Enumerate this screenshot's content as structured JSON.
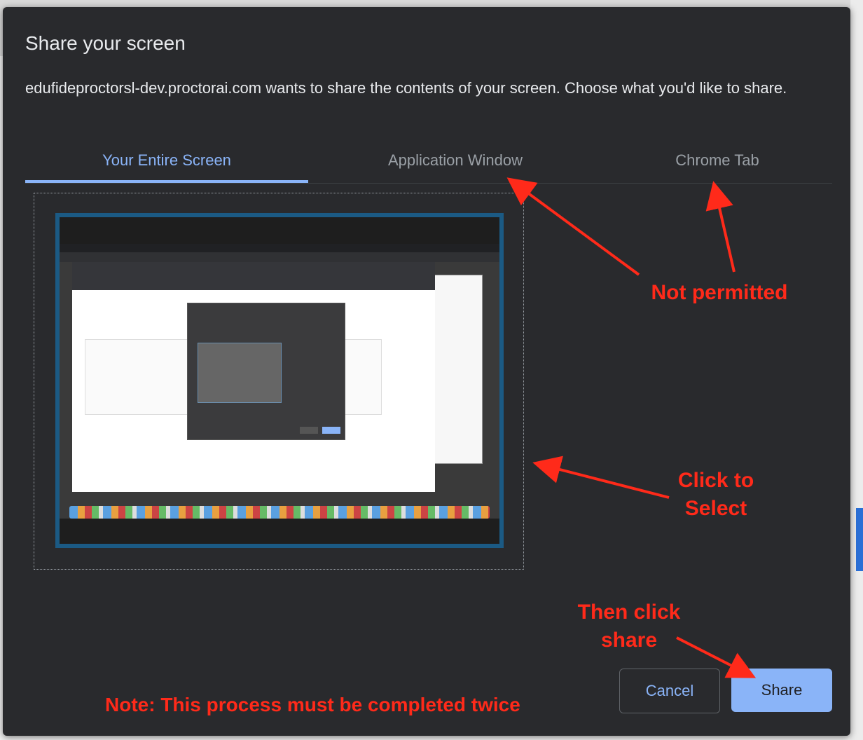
{
  "dialog": {
    "title": "Share your screen",
    "description": "edufideproctorsl-dev.proctorai.com wants to share the contents of your screen. Choose what you'd like to share."
  },
  "tabs": [
    {
      "label": "Your Entire Screen",
      "active": true
    },
    {
      "label": "Application Window",
      "active": false
    },
    {
      "label": "Chrome Tab",
      "active": false
    }
  ],
  "buttons": {
    "cancel": "Cancel",
    "share": "Share"
  },
  "annotations": {
    "not_permitted": "Not permitted",
    "click_to_select_line1": "Click to",
    "click_to_select_line2": "Select",
    "then_click_line1": "Then click",
    "then_click_line2": "share",
    "note": "Note: This process must be completed twice"
  },
  "colors": {
    "dialog_bg": "#292a2d",
    "accent": "#8ab4f8",
    "annotation": "#ff2a1a",
    "selected_border": "#1b5a84"
  }
}
